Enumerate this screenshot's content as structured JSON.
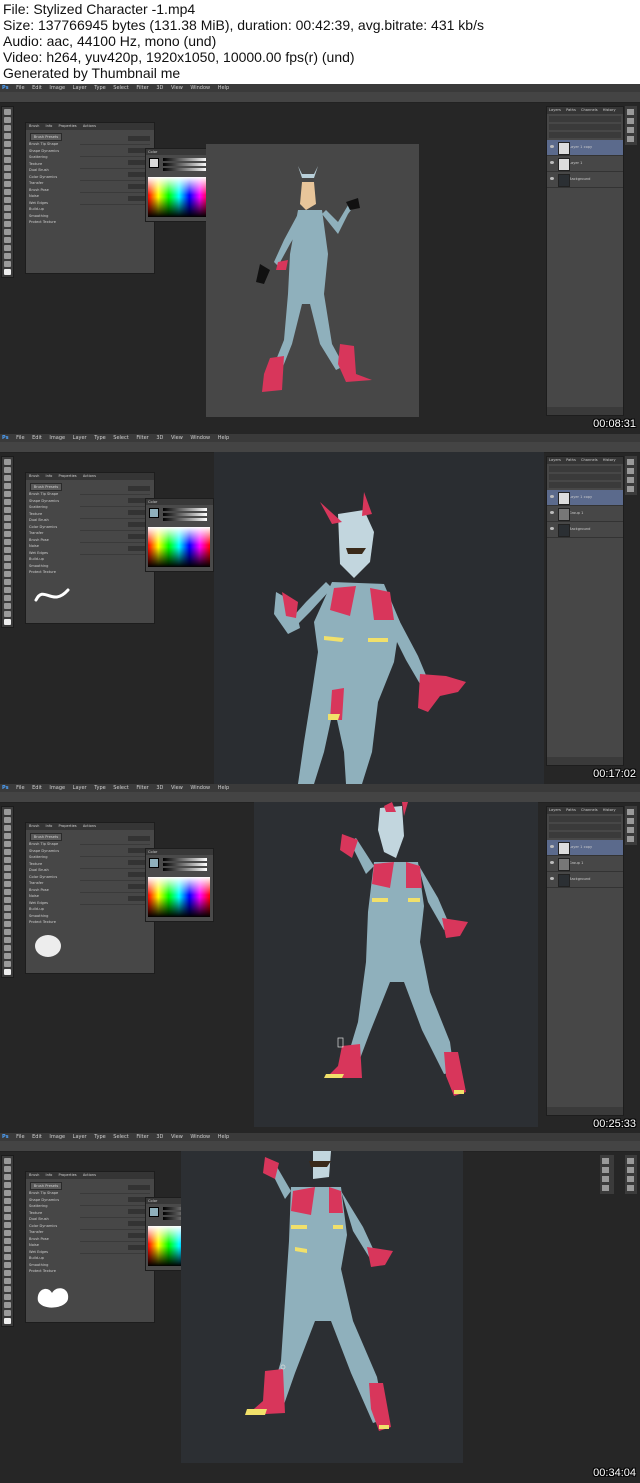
{
  "header": {
    "line1": "File: Stylized Character -1.mp4",
    "line2": "Size: 137766945 bytes (131.38 MiB), duration: 00:42:39, avg.bitrate: 431 kb/s",
    "line3": "Audio: aac, 44100 Hz, mono (und)",
    "line4": "Video: h264, yuv420p, 1920x1050, 10000.00 fps(r) (und)",
    "line5": "Generated by Thumbnail me"
  },
  "menu": {
    "app_icon": "Ps",
    "items": [
      "File",
      "Edit",
      "Image",
      "Layer",
      "Type",
      "Select",
      "Filter",
      "3D",
      "View",
      "Window",
      "Help"
    ]
  },
  "brush_panel": {
    "tabs": [
      "Brush",
      "Info",
      "Properties",
      "Actions"
    ],
    "preset_button": "Brush Presets",
    "tip_shape_label": "Brush Tip Shape",
    "options": [
      "Shape Dynamics",
      "Scattering",
      "Texture",
      "Dual Brush",
      "Color Dynamics",
      "Transfer",
      "Brush Pose",
      "Noise",
      "Wet Edges",
      "Build-up",
      "Smoothing",
      "Protect Texture"
    ]
  },
  "color_panel": {
    "title": "Color"
  },
  "layers_panel": {
    "tabs": [
      "Layers",
      "Paths",
      "Channels",
      "History"
    ],
    "frame1_layers": [
      "Layer 1 copy",
      "Layer 1",
      "Background"
    ],
    "frame2_layers": [
      "Layer 1 copy",
      "Group 1",
      "Background"
    ],
    "frame3_layers": [
      "Layer 1 copy",
      "Group 1",
      "Background"
    ]
  },
  "timestamps": [
    "00:08:31",
    "00:17:02",
    "00:25:33",
    "00:34:04"
  ],
  "colors": {
    "workspace": "#262626",
    "figure_body": "#8fb0bc",
    "accent_pink": "#d8365b",
    "accent_yellow": "#f1e06a"
  }
}
